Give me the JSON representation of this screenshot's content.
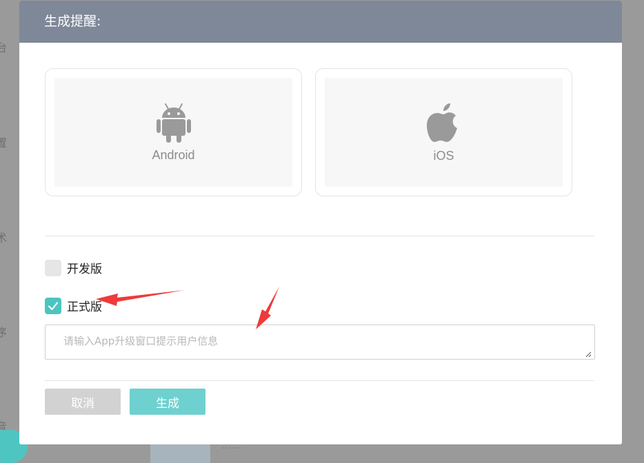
{
  "background": {
    "side_chars": [
      "台",
      "置",
      "术",
      "序",
      "音"
    ]
  },
  "modal": {
    "title": "生成提醒:",
    "platforms": [
      {
        "label": "Android",
        "icon": "android-icon"
      },
      {
        "label": "iOS",
        "icon": "apple-icon"
      }
    ],
    "options": [
      {
        "label": "开发版",
        "checked": false
      },
      {
        "label": "正式版",
        "checked": true
      }
    ],
    "message_input": {
      "value": "",
      "placeholder": "请输入App升级窗口提示用户信息"
    },
    "buttons": {
      "cancel": "取消",
      "generate": "生成"
    }
  },
  "colors": {
    "header": "#7e8898",
    "accent": "#4cc4c0",
    "generate_button": "#6ed1cf",
    "cancel_button": "#d2d2d2",
    "annotation_arrow": "#ee3b3b"
  }
}
